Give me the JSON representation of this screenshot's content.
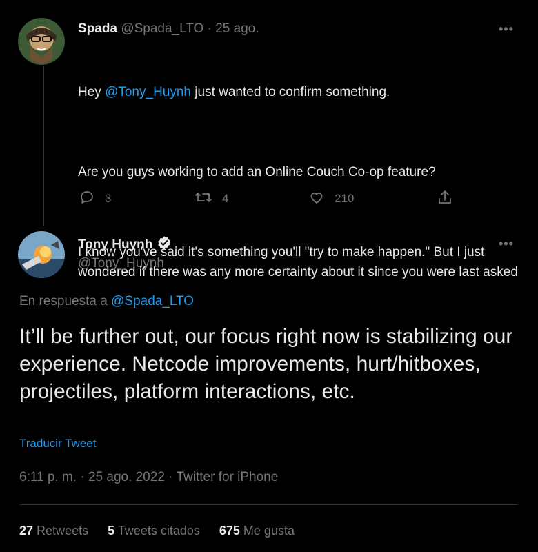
{
  "tweet1": {
    "author_name": "Spada",
    "author_handle": "@Spada_LTO",
    "separator": "·",
    "date": "25 ago.",
    "more": "•••",
    "body": {
      "line1_prefix": "Hey ",
      "line1_mention": "@Tony_Huynh",
      "line1_suffix": " just wanted to confirm something.",
      "para2": "Are you guys working to add an Online Couch Co-op feature?",
      "para3": "I know you've said it's something you'll \"try to make happen.\" But I just wondered if there was any more certainty about it since you were last asked"
    },
    "actions": {
      "reply_count": "3",
      "retweet_count": "4",
      "like_count": "210"
    }
  },
  "tweet2": {
    "author_name": "Tony Huynh",
    "author_handle": "@Tony_Huynh",
    "more": "•••",
    "reply_prefix": "En respuesta a ",
    "reply_mention": "@Spada_LTO",
    "body": "It’ll be further out, our focus right now is stabilizing our experience. Netcode improvements, hurt/hitboxes, projectiles, platform interactions, etc.",
    "translate_label": "Traducir Tweet",
    "meta": "6:11 p. m. · 25 ago. 2022 · Twitter for iPhone",
    "stats": {
      "retweets_count": "27",
      "retweets_label": "Retweets",
      "quotes_count": "5",
      "quotes_label": "Tweets citados",
      "likes_count": "675",
      "likes_label": "Me gusta"
    }
  },
  "colors": {
    "background": "#000000",
    "text": "#e7e9ea",
    "muted": "#71767b",
    "accent": "#1d9bf0"
  }
}
